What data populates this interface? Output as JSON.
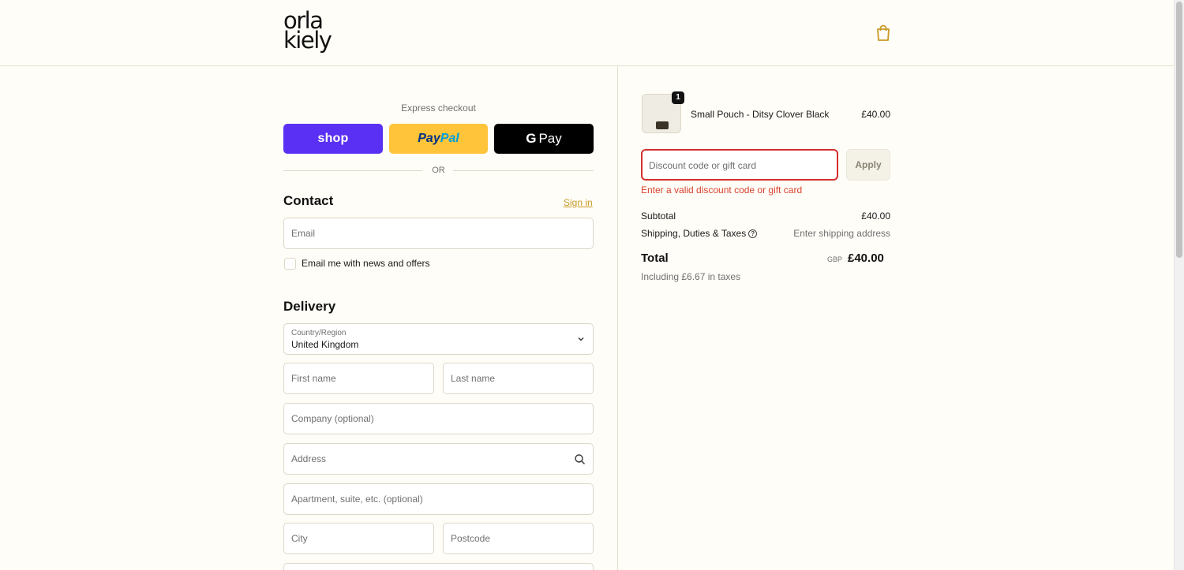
{
  "brand": {
    "logo_line1": "orla",
    "logo_line2": "kiely"
  },
  "header": {
    "cart_icon": "shopping-bag-icon",
    "accent": "#c79a26"
  },
  "express": {
    "label": "Express checkout",
    "shop_label": "shop",
    "paypal_label_1": "Pay",
    "paypal_label_2": "Pal",
    "gpay_g": "G",
    "gpay_label": "Pay",
    "or": "OR"
  },
  "contact": {
    "title": "Contact",
    "signin": "Sign in",
    "email_placeholder": "Email",
    "newsletter_label": "Email me with news and offers"
  },
  "delivery": {
    "title": "Delivery",
    "country_label": "Country/Region",
    "country_value": "United Kingdom",
    "first_name": "First name",
    "last_name": "Last name",
    "company": "Company (optional)",
    "address": "Address",
    "apartment": "Apartment, suite, etc. (optional)",
    "city": "City",
    "postcode": "Postcode"
  },
  "summary": {
    "item": {
      "name": "Small Pouch - Ditsy Clover Black",
      "price": "£40.00",
      "qty": "1"
    },
    "discount_placeholder": "Discount code or gift card",
    "apply": "Apply",
    "discount_error": "Enter a valid discount code or gift card",
    "subtotal_label": "Subtotal",
    "subtotal_value": "£40.00",
    "shipping_label": "Shipping, Duties & Taxes",
    "shipping_value": "Enter shipping address",
    "total_label": "Total",
    "total_currency": "GBP",
    "total_value": "£40.00",
    "taxes_note": "Including £6.67 in taxes"
  },
  "colors": {
    "error": "#d32f2f",
    "shop": "#5a31f4",
    "paypal": "#ffc439",
    "gpay": "#000000"
  }
}
